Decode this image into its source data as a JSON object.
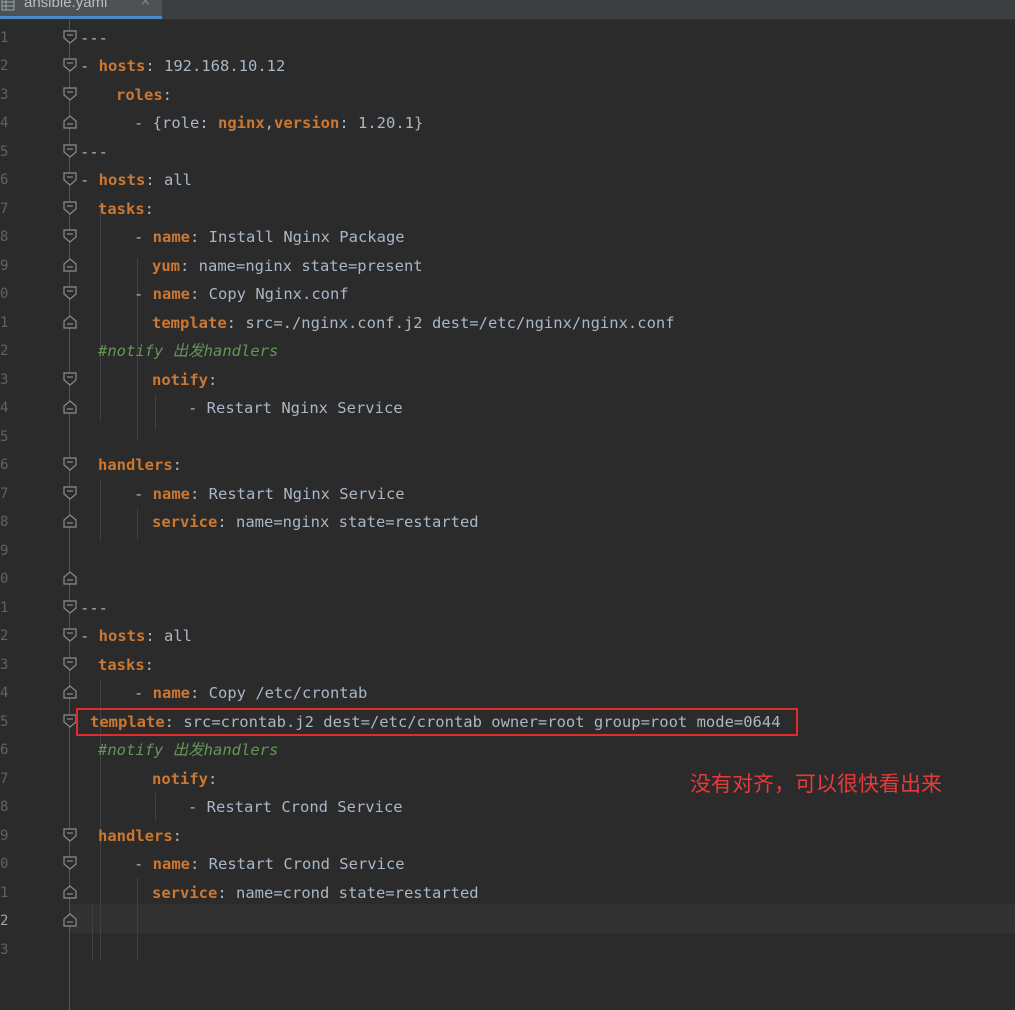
{
  "tab": {
    "filename": "ansible.yaml",
    "close_glyph": "×",
    "icon": "yaml-file-icon"
  },
  "line_numbers": [
    "1",
    "2",
    "3",
    "4",
    "5",
    "6",
    "7",
    "8",
    "9",
    "0",
    "1",
    "2",
    "3",
    "4",
    "5",
    "6",
    "7",
    "8",
    "9",
    "0",
    "1",
    "2",
    "3",
    "4",
    "5",
    "6",
    "7",
    "8",
    "9",
    "0",
    "1",
    "2",
    "3"
  ],
  "code_lines": [
    [
      {
        "t": "---",
        "c": "p"
      }
    ],
    [
      {
        "t": "- ",
        "c": "p"
      },
      {
        "t": "hosts",
        "c": "k"
      },
      {
        "t": ": 192.168.10.12",
        "c": "v"
      }
    ],
    [
      {
        "t": "roles",
        "c": "k"
      },
      {
        "t": ":",
        "c": "p"
      }
    ],
    [
      {
        "t": "- {role: ",
        "c": "p"
      },
      {
        "t": "nginx",
        "c": "k"
      },
      {
        "t": ",",
        "c": "p"
      },
      {
        "t": "version",
        "c": "k"
      },
      {
        "t": ": 1.20.1}",
        "c": "v"
      }
    ],
    [
      {
        "t": "---",
        "c": "p"
      }
    ],
    [
      {
        "t": "- ",
        "c": "p"
      },
      {
        "t": "hosts",
        "c": "k"
      },
      {
        "t": ": all",
        "c": "v"
      }
    ],
    [
      {
        "t": "tasks",
        "c": "k"
      },
      {
        "t": ":",
        "c": "p"
      }
    ],
    [
      {
        "t": "- ",
        "c": "p"
      },
      {
        "t": "name",
        "c": "k"
      },
      {
        "t": ": Install Nginx Package",
        "c": "v"
      }
    ],
    [
      {
        "t": "yum",
        "c": "k"
      },
      {
        "t": ": name=nginx state=present",
        "c": "v"
      }
    ],
    [
      {
        "t": "- ",
        "c": "p"
      },
      {
        "t": "name",
        "c": "k"
      },
      {
        "t": ": Copy Nginx.conf",
        "c": "v"
      }
    ],
    [
      {
        "t": "template",
        "c": "k"
      },
      {
        "t": ": src=./nginx.conf.j2 dest=/etc/nginx/nginx.conf",
        "c": "v"
      }
    ],
    [
      {
        "t": "#notify 出发handlers",
        "c": "c"
      }
    ],
    [
      {
        "t": "notify",
        "c": "k"
      },
      {
        "t": ":",
        "c": "p"
      }
    ],
    [
      {
        "t": "- Restart Nginx Service",
        "c": "v"
      }
    ],
    [],
    [
      {
        "t": "handlers",
        "c": "k"
      },
      {
        "t": ":",
        "c": "p"
      }
    ],
    [
      {
        "t": "- ",
        "c": "p"
      },
      {
        "t": "name",
        "c": "k"
      },
      {
        "t": ": Restart Nginx Service",
        "c": "v"
      }
    ],
    [
      {
        "t": "service",
        "c": "k"
      },
      {
        "t": ": name=nginx state=restarted",
        "c": "v"
      }
    ],
    [],
    [],
    [
      {
        "t": "---",
        "c": "p"
      }
    ],
    [
      {
        "t": "- ",
        "c": "p"
      },
      {
        "t": "hosts",
        "c": "k"
      },
      {
        "t": ": all",
        "c": "v"
      }
    ],
    [
      {
        "t": "tasks",
        "c": "k"
      },
      {
        "t": ":",
        "c": "p"
      }
    ],
    [
      {
        "t": "- ",
        "c": "p"
      },
      {
        "t": "name",
        "c": "k"
      },
      {
        "t": ": Copy /etc/crontab",
        "c": "v"
      }
    ],
    [
      {
        "t": "template",
        "c": "k"
      },
      {
        "t": ": src=crontab.j2 dest=/etc/crontab owner=root group=root mode=0644",
        "c": "v"
      }
    ],
    [
      {
        "t": "#notify 出发handlers",
        "c": "c"
      }
    ],
    [
      {
        "t": "notify",
        "c": "k"
      },
      {
        "t": ":",
        "c": "p"
      }
    ],
    [
      {
        "t": "- Restart Crond Service",
        "c": "v"
      }
    ],
    [
      {
        "t": "handlers",
        "c": "k"
      },
      {
        "t": ":",
        "c": "p"
      }
    ],
    [
      {
        "t": "- ",
        "c": "p"
      },
      {
        "t": "name",
        "c": "k"
      },
      {
        "t": ": Restart Crond Service",
        "c": "v"
      }
    ],
    [
      {
        "t": "service",
        "c": "k"
      },
      {
        "t": ": name=crond state=restarted",
        "c": "v"
      }
    ],
    [],
    []
  ],
  "fold_markers": [
    "open",
    "open",
    "open",
    "close",
    "open",
    "open",
    "open",
    "open",
    "close",
    "open",
    "close",
    "none",
    "open",
    "close",
    "none",
    "open",
    "open",
    "close",
    "none",
    "close",
    "open",
    "open",
    "open",
    "close",
    "open",
    "none",
    "none",
    "none",
    "open",
    "open",
    "close",
    "close",
    "none"
  ],
  "annotation": "没有对齐，可以很快看出来",
  "colors": {
    "background": "#2b2b2b",
    "keyword": "#cc7832",
    "comment": "#629755",
    "text": "#a9b7c6",
    "annotation": "#e02b2b"
  }
}
